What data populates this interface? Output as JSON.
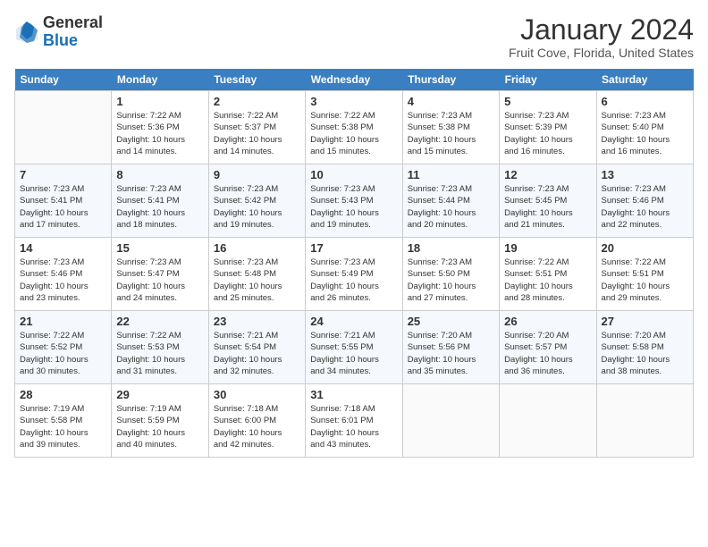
{
  "header": {
    "logo_general": "General",
    "logo_blue": "Blue",
    "month_title": "January 2024",
    "subtitle": "Fruit Cove, Florida, United States"
  },
  "days_of_week": [
    "Sunday",
    "Monday",
    "Tuesday",
    "Wednesday",
    "Thursday",
    "Friday",
    "Saturday"
  ],
  "weeks": [
    [
      {
        "num": "",
        "info": ""
      },
      {
        "num": "1",
        "info": "Sunrise: 7:22 AM\nSunset: 5:36 PM\nDaylight: 10 hours\nand 14 minutes."
      },
      {
        "num": "2",
        "info": "Sunrise: 7:22 AM\nSunset: 5:37 PM\nDaylight: 10 hours\nand 14 minutes."
      },
      {
        "num": "3",
        "info": "Sunrise: 7:22 AM\nSunset: 5:38 PM\nDaylight: 10 hours\nand 15 minutes."
      },
      {
        "num": "4",
        "info": "Sunrise: 7:23 AM\nSunset: 5:38 PM\nDaylight: 10 hours\nand 15 minutes."
      },
      {
        "num": "5",
        "info": "Sunrise: 7:23 AM\nSunset: 5:39 PM\nDaylight: 10 hours\nand 16 minutes."
      },
      {
        "num": "6",
        "info": "Sunrise: 7:23 AM\nSunset: 5:40 PM\nDaylight: 10 hours\nand 16 minutes."
      }
    ],
    [
      {
        "num": "7",
        "info": "Sunrise: 7:23 AM\nSunset: 5:41 PM\nDaylight: 10 hours\nand 17 minutes."
      },
      {
        "num": "8",
        "info": "Sunrise: 7:23 AM\nSunset: 5:41 PM\nDaylight: 10 hours\nand 18 minutes."
      },
      {
        "num": "9",
        "info": "Sunrise: 7:23 AM\nSunset: 5:42 PM\nDaylight: 10 hours\nand 19 minutes."
      },
      {
        "num": "10",
        "info": "Sunrise: 7:23 AM\nSunset: 5:43 PM\nDaylight: 10 hours\nand 19 minutes."
      },
      {
        "num": "11",
        "info": "Sunrise: 7:23 AM\nSunset: 5:44 PM\nDaylight: 10 hours\nand 20 minutes."
      },
      {
        "num": "12",
        "info": "Sunrise: 7:23 AM\nSunset: 5:45 PM\nDaylight: 10 hours\nand 21 minutes."
      },
      {
        "num": "13",
        "info": "Sunrise: 7:23 AM\nSunset: 5:46 PM\nDaylight: 10 hours\nand 22 minutes."
      }
    ],
    [
      {
        "num": "14",
        "info": "Sunrise: 7:23 AM\nSunset: 5:46 PM\nDaylight: 10 hours\nand 23 minutes."
      },
      {
        "num": "15",
        "info": "Sunrise: 7:23 AM\nSunset: 5:47 PM\nDaylight: 10 hours\nand 24 minutes."
      },
      {
        "num": "16",
        "info": "Sunrise: 7:23 AM\nSunset: 5:48 PM\nDaylight: 10 hours\nand 25 minutes."
      },
      {
        "num": "17",
        "info": "Sunrise: 7:23 AM\nSunset: 5:49 PM\nDaylight: 10 hours\nand 26 minutes."
      },
      {
        "num": "18",
        "info": "Sunrise: 7:23 AM\nSunset: 5:50 PM\nDaylight: 10 hours\nand 27 minutes."
      },
      {
        "num": "19",
        "info": "Sunrise: 7:22 AM\nSunset: 5:51 PM\nDaylight: 10 hours\nand 28 minutes."
      },
      {
        "num": "20",
        "info": "Sunrise: 7:22 AM\nSunset: 5:51 PM\nDaylight: 10 hours\nand 29 minutes."
      }
    ],
    [
      {
        "num": "21",
        "info": "Sunrise: 7:22 AM\nSunset: 5:52 PM\nDaylight: 10 hours\nand 30 minutes."
      },
      {
        "num": "22",
        "info": "Sunrise: 7:22 AM\nSunset: 5:53 PM\nDaylight: 10 hours\nand 31 minutes."
      },
      {
        "num": "23",
        "info": "Sunrise: 7:21 AM\nSunset: 5:54 PM\nDaylight: 10 hours\nand 32 minutes."
      },
      {
        "num": "24",
        "info": "Sunrise: 7:21 AM\nSunset: 5:55 PM\nDaylight: 10 hours\nand 34 minutes."
      },
      {
        "num": "25",
        "info": "Sunrise: 7:20 AM\nSunset: 5:56 PM\nDaylight: 10 hours\nand 35 minutes."
      },
      {
        "num": "26",
        "info": "Sunrise: 7:20 AM\nSunset: 5:57 PM\nDaylight: 10 hours\nand 36 minutes."
      },
      {
        "num": "27",
        "info": "Sunrise: 7:20 AM\nSunset: 5:58 PM\nDaylight: 10 hours\nand 38 minutes."
      }
    ],
    [
      {
        "num": "28",
        "info": "Sunrise: 7:19 AM\nSunset: 5:58 PM\nDaylight: 10 hours\nand 39 minutes."
      },
      {
        "num": "29",
        "info": "Sunrise: 7:19 AM\nSunset: 5:59 PM\nDaylight: 10 hours\nand 40 minutes."
      },
      {
        "num": "30",
        "info": "Sunrise: 7:18 AM\nSunset: 6:00 PM\nDaylight: 10 hours\nand 42 minutes."
      },
      {
        "num": "31",
        "info": "Sunrise: 7:18 AM\nSunset: 6:01 PM\nDaylight: 10 hours\nand 43 minutes."
      },
      {
        "num": "",
        "info": ""
      },
      {
        "num": "",
        "info": ""
      },
      {
        "num": "",
        "info": ""
      }
    ]
  ]
}
